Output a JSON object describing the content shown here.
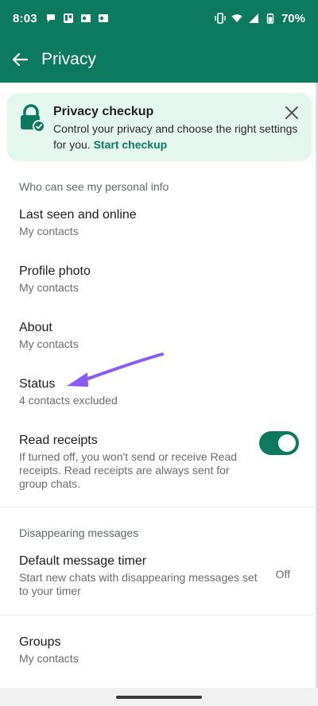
{
  "status_bar": {
    "time": "8:03",
    "battery": "70%"
  },
  "app_bar": {
    "title": "Privacy"
  },
  "checkup": {
    "title": "Privacy checkup",
    "body": "Control your privacy and choose the right settings for you.",
    "link": "Start checkup"
  },
  "personal_info": {
    "header": "Who can see my personal info",
    "items": [
      {
        "title": "Last seen and online",
        "value": "My contacts"
      },
      {
        "title": "Profile photo",
        "value": "My contacts"
      },
      {
        "title": "About",
        "value": "My contacts"
      },
      {
        "title": "Status",
        "value": "4 contacts excluded"
      }
    ]
  },
  "read_receipts": {
    "title": "Read receipts",
    "description": "If turned off, you won't send or receive Read receipts. Read receipts are always sent for group chats.",
    "enabled": true
  },
  "disappearing": {
    "header": "Disappearing messages",
    "timer_title": "Default message timer",
    "timer_description": "Start new chats with disappearing messages set to your timer",
    "timer_value": "Off"
  },
  "groups": {
    "title": "Groups",
    "value": "My contacts"
  },
  "colors": {
    "accent": "#0b7a5e",
    "card_bg": "#e4f7ee",
    "arrow": "#8a5cf5"
  }
}
